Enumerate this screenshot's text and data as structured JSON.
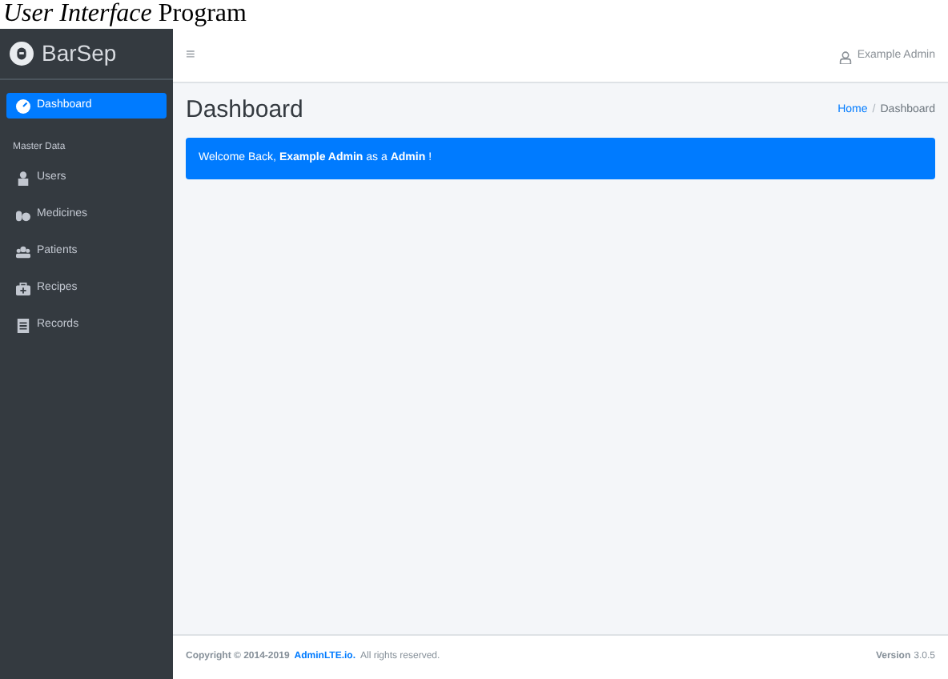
{
  "caption": "*User Interface* Program",
  "brand": {
    "name": "BarSep"
  },
  "sidebar": {
    "items": [
      {
        "label": "Dashboard",
        "selected": true,
        "kind": "dashboard"
      }
    ],
    "section": "Master Data",
    "master_items": [
      {
        "label": "Users",
        "selected": false,
        "kind": "user"
      },
      {
        "label": "Medicines",
        "selected": false,
        "kind": "pills"
      },
      {
        "label": "Patients",
        "selected": false,
        "kind": "group"
      },
      {
        "label": "Recipes",
        "selected": false,
        "kind": "kit"
      },
      {
        "label": "Records",
        "selected": false,
        "kind": "file"
      }
    ]
  },
  "topbar": {
    "menu": "≡",
    "user": "Example Admin"
  },
  "header": {
    "title": "Dashboard",
    "breadcrumb": [
      "Home",
      "Dashboard"
    ],
    "separator": "/"
  },
  "alert": "Welcome Back, **Example Admin** as a **Admin** !",
  "footer": {
    "copyright": "Copyright © 2014-2019",
    "link": "AdminLTE.io.",
    "rights": "All rights reserved.",
    "version_label": "Version",
    "version": "3.0.5"
  }
}
